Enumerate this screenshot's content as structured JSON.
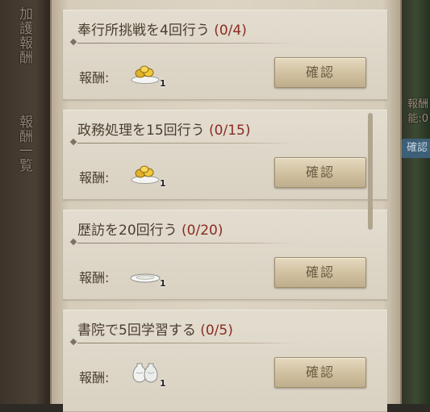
{
  "side_left": {
    "top_text": "加護報酬",
    "bottom_text": "報酬一覧"
  },
  "side_right": {
    "line1": "報酬",
    "line2": "能:0",
    "badge": "確認"
  },
  "reward_label": "報酬:",
  "confirm_label": "確認",
  "tasks": [
    {
      "title": "奉行所挑戦を4回行う",
      "progress": "(0/4)",
      "reward_icon": "gold-ingots-on-plate-icon",
      "reward_count": "1"
    },
    {
      "title": "政務処理を15回行う",
      "progress": "(0/15)",
      "reward_icon": "gold-ingots-on-plate-icon",
      "reward_count": "1"
    },
    {
      "title": "歴訪を20回行う",
      "progress": "(0/20)",
      "reward_icon": "silver-plate-icon",
      "reward_count": "1"
    },
    {
      "title": "書院で5回学習する",
      "progress": "(0/5)",
      "reward_icon": "porcelain-jars-icon",
      "reward_count": "1"
    }
  ]
}
